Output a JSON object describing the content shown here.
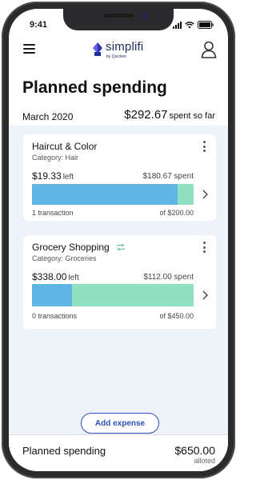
{
  "status_bar": {
    "time": "9:41"
  },
  "header": {
    "brand": "simplifi",
    "brand_sub": "by Quicken"
  },
  "page": {
    "title": "Planned spending",
    "month": "March 2020",
    "spent_total": "$292.67",
    "spent_suffix": "spent so far"
  },
  "cards": [
    {
      "title": "Haircut & Color",
      "category": "Category: Hair",
      "left_amount": "$19.33",
      "left_label": "left",
      "spent": "$180.67 spent",
      "progress_spent_fraction": 0.9034,
      "transactions": "1 transaction",
      "of_amount": "of $200.00",
      "recurring": false
    },
    {
      "title": "Grocery Shopping",
      "category": "Category: Groceries",
      "left_amount": "$338.00",
      "left_label": "left",
      "spent": "$112.00 spent",
      "progress_spent_fraction": 0.2489,
      "transactions": "0 transactions",
      "of_amount": "of $450.00",
      "recurring": true
    }
  ],
  "actions": {
    "add_expense": "Add expense"
  },
  "footer": {
    "label": "Planned spending",
    "amount": "$650.00",
    "sub": "alloted"
  },
  "colors": {
    "bar_spent": "#5fb6e5",
    "bar_remaining": "#8fe1c2",
    "accent": "#2f4fb8",
    "list_bg": "#eef3fa"
  }
}
